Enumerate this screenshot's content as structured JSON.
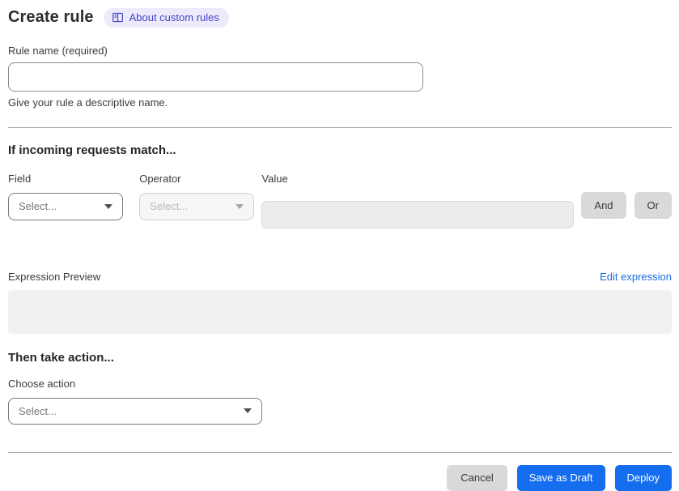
{
  "header": {
    "title": "Create rule",
    "badge": {
      "label": "About custom rules",
      "icon": "book-icon"
    }
  },
  "rule_name": {
    "label": "Rule name (required)",
    "value": "",
    "placeholder": "",
    "helper": "Give your rule a descriptive name."
  },
  "match_section": {
    "heading": "If incoming requests match...",
    "field": {
      "label": "Field",
      "selected": "Select..."
    },
    "operator": {
      "label": "Operator",
      "selected": "Select...",
      "disabled": true
    },
    "value": {
      "label": "Value",
      "value": "",
      "disabled": true
    },
    "and_button": "And",
    "or_button": "Or"
  },
  "expression": {
    "label": "Expression Preview",
    "edit_link": "Edit expression",
    "preview_text": ""
  },
  "action_section": {
    "heading": "Then take action...",
    "choose_label": "Choose action",
    "selected": "Select..."
  },
  "footer": {
    "cancel": "Cancel",
    "save_draft": "Save as Draft",
    "deploy": "Deploy"
  },
  "colors": {
    "primary_blue": "#156df0",
    "link_blue": "#1b6ce0",
    "badge_bg": "#edebfb",
    "badge_text": "#4242c8",
    "gray_button_bg": "#d9d9d9",
    "disabled_field_bg": "#f6f6f6",
    "disabled_value_bg": "#ececec",
    "preview_box_bg": "#f1f1f1",
    "divider": "#a8a8a8"
  }
}
